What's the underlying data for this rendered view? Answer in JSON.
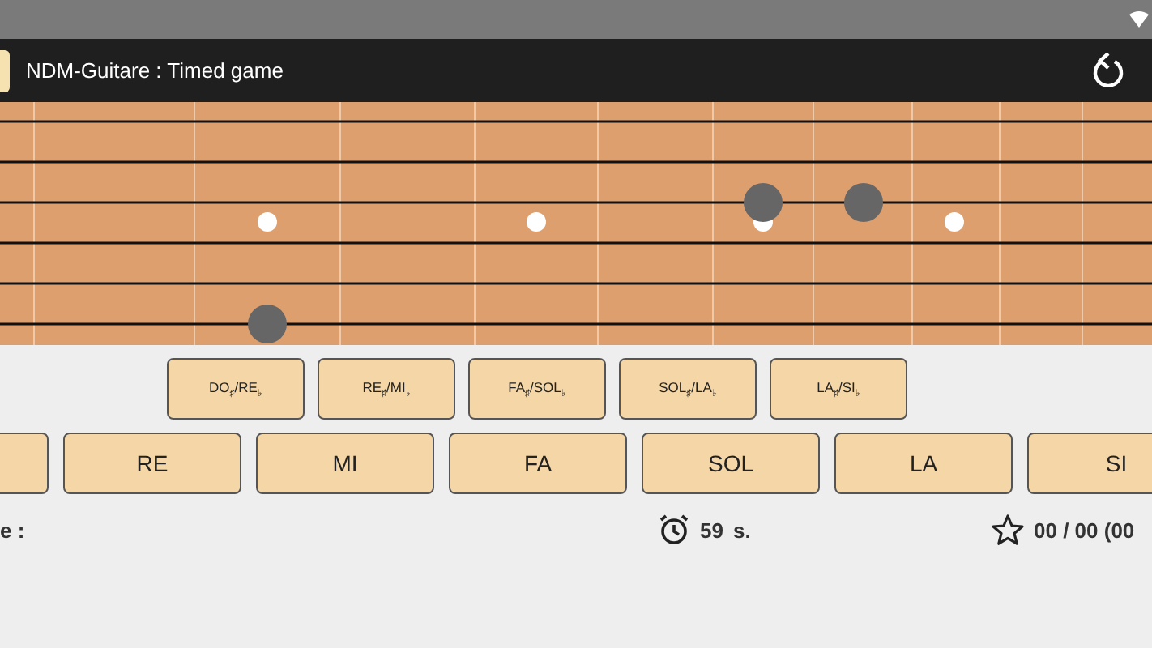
{
  "app_bar": {
    "title": "NDM-Guitare : Timed game"
  },
  "sharp_buttons": [
    "DO$_{♯}$/RE$_{♭}$",
    "RE$_{♯}$/MI$_{♭}$",
    "FA$_{♯}$/SOL$_{♭}$",
    "SOL$_{♯}$/LA$_{♭}$",
    "LA$_{♯}$/SI$_{♭}$"
  ],
  "note_buttons": [
    {
      "kind": "cut"
    },
    {
      "kind": "note",
      "label": "RE"
    },
    {
      "kind": "note",
      "label": "MI"
    },
    {
      "kind": "note",
      "label": "FA"
    },
    {
      "kind": "note",
      "label": "SOL"
    },
    {
      "kind": "note",
      "label": "LA"
    },
    {
      "kind": "note",
      "label": "SI"
    }
  ],
  "footer": {
    "label": "e :",
    "timer": "59",
    "timer_unit": "s.",
    "score": "00 / 00 (00"
  }
}
